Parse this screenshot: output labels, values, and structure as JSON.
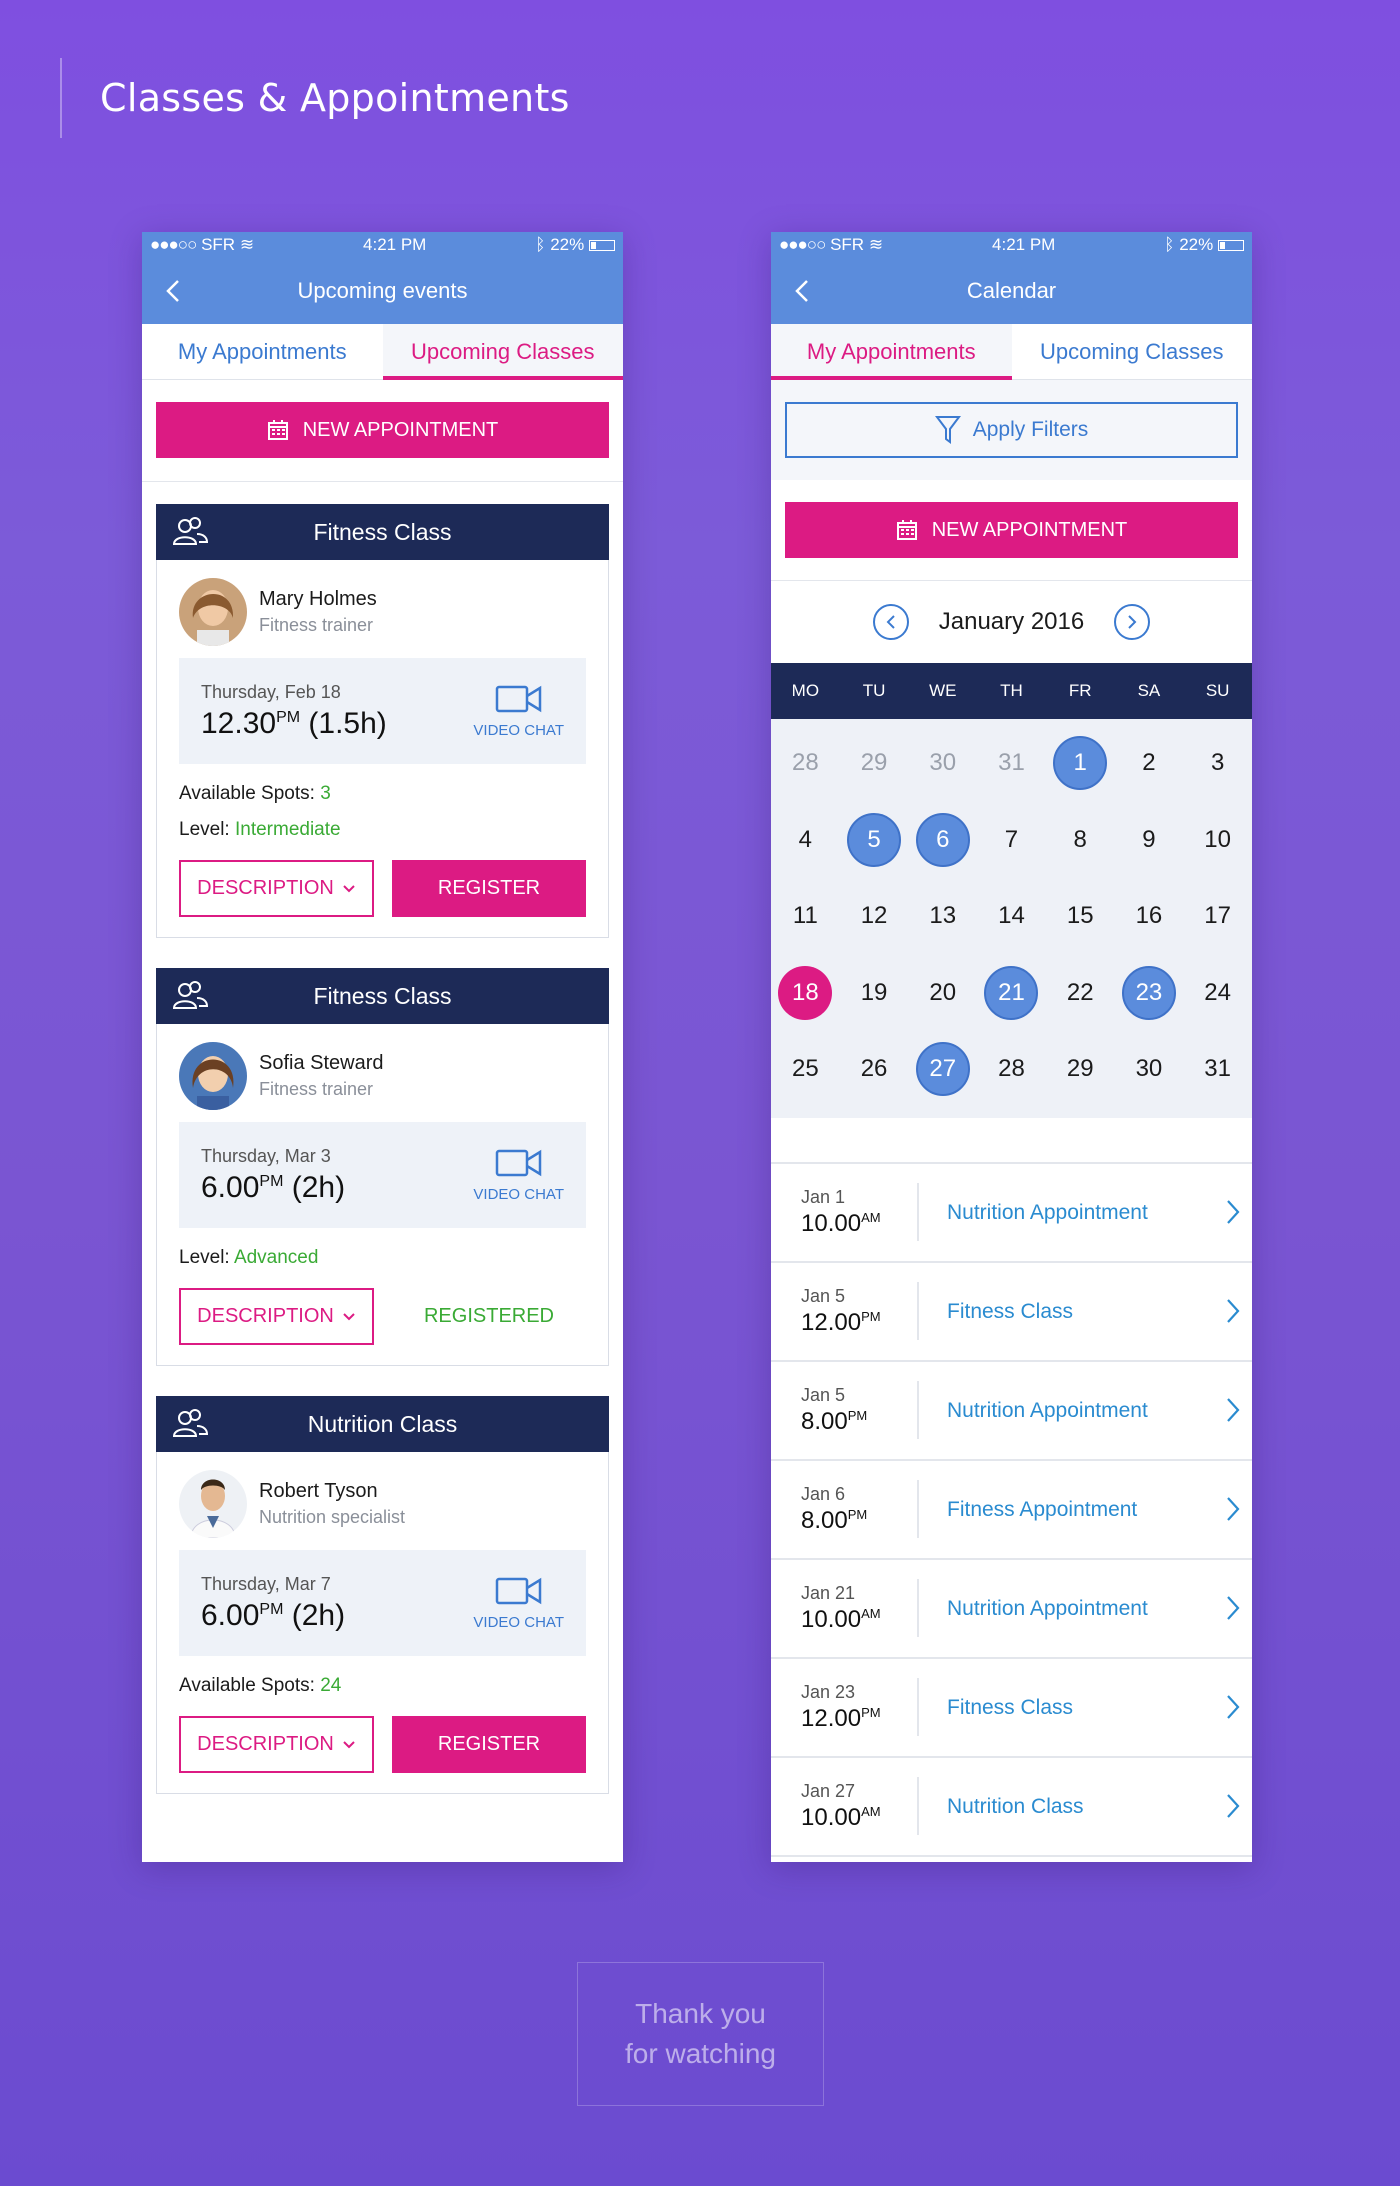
{
  "page": {
    "title": "Classes & Appointments",
    "thanks_line1": "Thank you",
    "thanks_line2": "for watching"
  },
  "status": {
    "signal": "●●●○○",
    "carrier": "SFR",
    "time": "4:21 PM",
    "battery": "22%"
  },
  "left": {
    "nav_title": "Upcoming events",
    "tabs": [
      "My Appointments",
      "Upcoming Classes"
    ],
    "active_tab": 1,
    "new_appointment": "NEW APPOINTMENT",
    "cards": [
      {
        "title": "Fitness Class",
        "trainer": "Mary Holmes",
        "role": "Fitness trainer",
        "day": "Thursday, Feb 18",
        "time": "12.30",
        "ampm": "PM",
        "duration": "(1.5h)",
        "video": "VIDEO CHAT",
        "spots_label": "Available Spots:",
        "spots": "3",
        "level_label": "Level:",
        "level": "Intermediate",
        "desc": "DESCRIPTION",
        "action": "REGISTER"
      },
      {
        "title": "Fitness Class",
        "trainer": "Sofia Steward",
        "role": "Fitness trainer",
        "day": "Thursday, Mar 3",
        "time": "6.00",
        "ampm": "PM",
        "duration": "(2h)",
        "video": "VIDEO CHAT",
        "level_label": "Level:",
        "level": "Advanced",
        "desc": "DESCRIPTION",
        "action": "REGISTERED"
      },
      {
        "title": "Nutrition Class",
        "trainer": "Robert Tyson",
        "role": "Nutrition specialist",
        "day": "Thursday, Mar 7",
        "time": "6.00",
        "ampm": "PM",
        "duration": "(2h)",
        "video": "VIDEO CHAT",
        "spots_label": "Available Spots:",
        "spots": "24",
        "desc": "DESCRIPTION",
        "action": "REGISTER"
      }
    ]
  },
  "right": {
    "nav_title": "Calendar",
    "tabs": [
      "My Appointments",
      "Upcoming Classes"
    ],
    "active_tab": 0,
    "filter": "Apply Filters",
    "new_appointment": "NEW APPOINTMENT",
    "month": "January 2016",
    "weekdays": [
      "MO",
      "TU",
      "WE",
      "TH",
      "FR",
      "SA",
      "SU"
    ],
    "days": [
      {
        "n": "28",
        "s": "muted"
      },
      {
        "n": "29",
        "s": "muted"
      },
      {
        "n": "30",
        "s": "muted"
      },
      {
        "n": "31",
        "s": "muted"
      },
      {
        "n": "1",
        "s": "blue"
      },
      {
        "n": "2",
        "s": ""
      },
      {
        "n": "3",
        "s": ""
      },
      {
        "n": "4",
        "s": ""
      },
      {
        "n": "5",
        "s": "blue"
      },
      {
        "n": "6",
        "s": "blue"
      },
      {
        "n": "7",
        "s": ""
      },
      {
        "n": "8",
        "s": ""
      },
      {
        "n": "9",
        "s": ""
      },
      {
        "n": "10",
        "s": ""
      },
      {
        "n": "11",
        "s": ""
      },
      {
        "n": "12",
        "s": ""
      },
      {
        "n": "13",
        "s": ""
      },
      {
        "n": "14",
        "s": ""
      },
      {
        "n": "15",
        "s": ""
      },
      {
        "n": "16",
        "s": ""
      },
      {
        "n": "17",
        "s": ""
      },
      {
        "n": "18",
        "s": "pink"
      },
      {
        "n": "19",
        "s": ""
      },
      {
        "n": "20",
        "s": ""
      },
      {
        "n": "21",
        "s": "blue"
      },
      {
        "n": "22",
        "s": ""
      },
      {
        "n": "23",
        "s": "blue"
      },
      {
        "n": "24",
        "s": ""
      },
      {
        "n": "25",
        "s": ""
      },
      {
        "n": "26",
        "s": ""
      },
      {
        "n": "27",
        "s": "blue"
      },
      {
        "n": "28",
        "s": ""
      },
      {
        "n": "29",
        "s": ""
      },
      {
        "n": "30",
        "s": ""
      },
      {
        "n": "31",
        "s": ""
      }
    ],
    "appointments": [
      {
        "date": "Jan 1",
        "time": "10.00",
        "ampm": "AM",
        "title": "Nutrition Appointment"
      },
      {
        "date": "Jan 5",
        "time": "12.00",
        "ampm": "PM",
        "title": "Fitness Class"
      },
      {
        "date": "Jan 5",
        "time": "8.00",
        "ampm": "PM",
        "title": "Nutrition Appointment"
      },
      {
        "date": "Jan 6",
        "time": "8.00",
        "ampm": "PM",
        "title": "Fitness Appointment"
      },
      {
        "date": "Jan 21",
        "time": "10.00",
        "ampm": "AM",
        "title": "Nutrition Appointment"
      },
      {
        "date": "Jan 23",
        "time": "12.00",
        "ampm": "PM",
        "title": "Fitness Class"
      },
      {
        "date": "Jan 27",
        "time": "10.00",
        "ampm": "AM",
        "title": "Nutrition Class"
      }
    ]
  },
  "colors": {
    "accent": "#dc1b83",
    "primary": "#5b8cdc",
    "navy": "#1d2a57",
    "link": "#2a8bd0",
    "green": "#3aaa35"
  }
}
